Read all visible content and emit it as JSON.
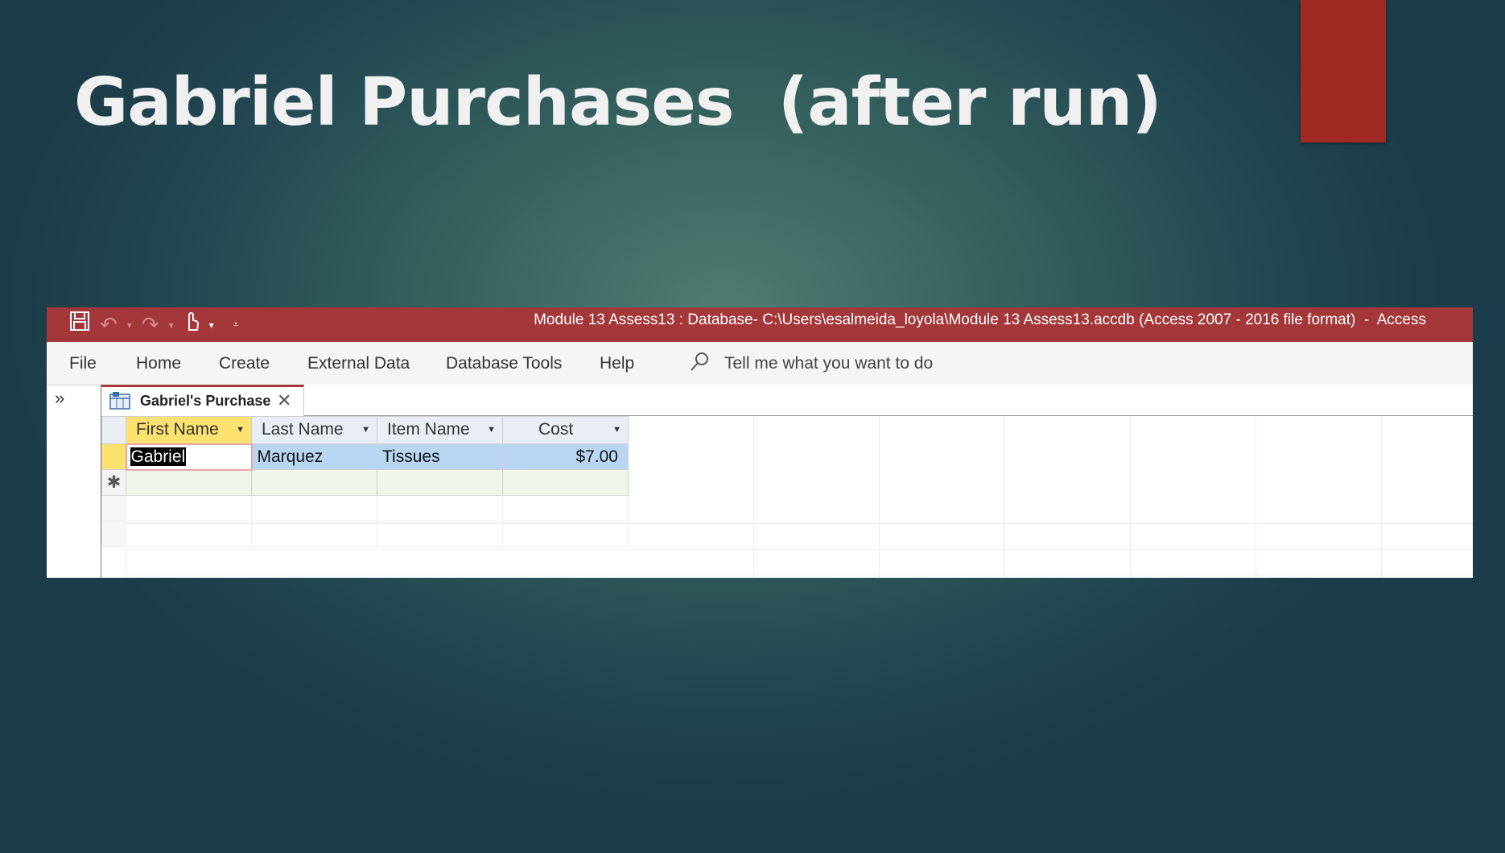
{
  "slide": {
    "title": "Gabriel Purchases  (after run)",
    "accent_color": "#a02a22"
  },
  "window": {
    "title": "Module 13 Assess13 : Database- C:\\Users\\esalmeida_loyola\\Module 13 Assess13.accdb (Access 2007 - 2016 file format)  -  Access",
    "quick_access": [
      "save-icon",
      "undo-icon",
      "redo-icon",
      "touch-mode-icon",
      "customize-icon"
    ],
    "titlebar_color": "#a4373a"
  },
  "ribbon": {
    "tabs": [
      "File",
      "Home",
      "Create",
      "External Data",
      "Database Tools",
      "Help"
    ],
    "tell_me": "Tell me what you want to do"
  },
  "nav_pane": {
    "toggle_glyph": "»"
  },
  "document": {
    "tab_label": "Gabriel's Purchase",
    "close_glyph": "✕"
  },
  "datasheet": {
    "columns": [
      "First Name",
      "Last Name",
      "Item Name",
      "Cost"
    ],
    "rows": [
      {
        "first_name": "Gabriel",
        "last_name": "Marquez",
        "item_name": "Tissues",
        "cost": "$7.00"
      }
    ],
    "new_record_glyph": "✱",
    "selected_column": "First Name"
  }
}
